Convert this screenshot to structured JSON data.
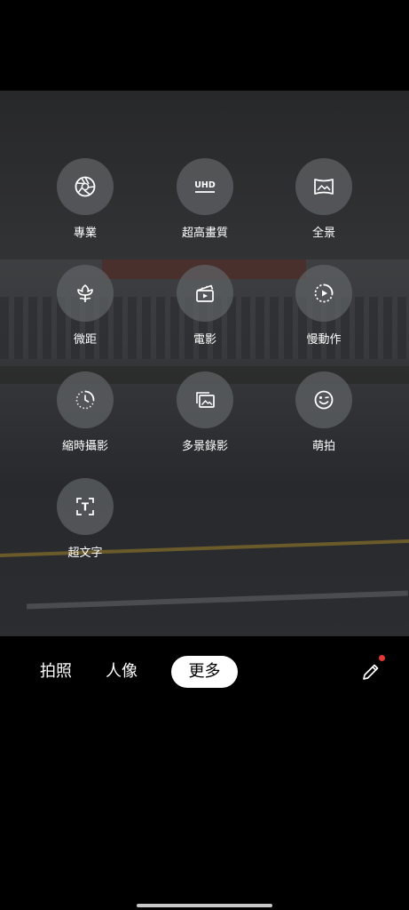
{
  "modes": [
    {
      "label": "專業",
      "icon": "aperture-icon"
    },
    {
      "label": "超高畫質",
      "icon": "uhd-icon"
    },
    {
      "label": "全景",
      "icon": "panorama-icon"
    },
    {
      "label": "微距",
      "icon": "flower-icon"
    },
    {
      "label": "電影",
      "icon": "clapperboard-icon"
    },
    {
      "label": "慢動作",
      "icon": "slow-motion-icon"
    },
    {
      "label": "縮時攝影",
      "icon": "timelapse-icon"
    },
    {
      "label": "多景錄影",
      "icon": "multi-view-icon"
    },
    {
      "label": "萌拍",
      "icon": "smiley-icon"
    },
    {
      "label": "超文字",
      "icon": "text-scan-icon"
    }
  ],
  "uhd_text": "UHD",
  "text_scan_letter": "T",
  "tabs": {
    "photo": "拍照",
    "portrait": "人像",
    "more": "更多"
  },
  "colors": {
    "notification_dot": "#e53935",
    "active_tab_bg": "#ffffff"
  }
}
